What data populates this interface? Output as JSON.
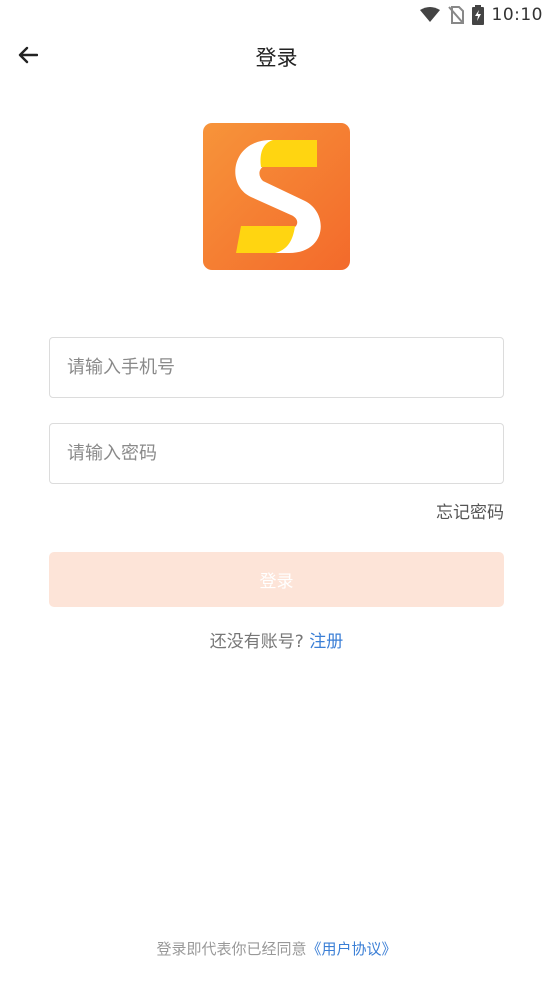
{
  "status_bar": {
    "time": "10:10",
    "icons": [
      "wifi-icon",
      "no-sim-icon",
      "battery-charging-icon"
    ]
  },
  "header": {
    "title": "登录",
    "back_icon": "arrow-left-icon"
  },
  "logo": {
    "icon": "app-logo-s",
    "colors": {
      "gradient_start": "#F7943A",
      "gradient_end": "#F36A2B",
      "accent_yellow": "#FFD511",
      "white": "#FFFFFF"
    }
  },
  "form": {
    "phone_placeholder": "请输入手机号",
    "phone_value": "",
    "password_placeholder": "请输入密码",
    "password_value": "",
    "forgot_password": "忘记密码",
    "login_button": "登录",
    "no_account": "还没有账号?",
    "register": "注册"
  },
  "footer": {
    "agreement_text": "登录即代表你已经同意",
    "agreement_link": "《用户协议》"
  },
  "colors": {
    "login_button_bg": "#FDE4D8",
    "link": "#3B7FD6"
  }
}
